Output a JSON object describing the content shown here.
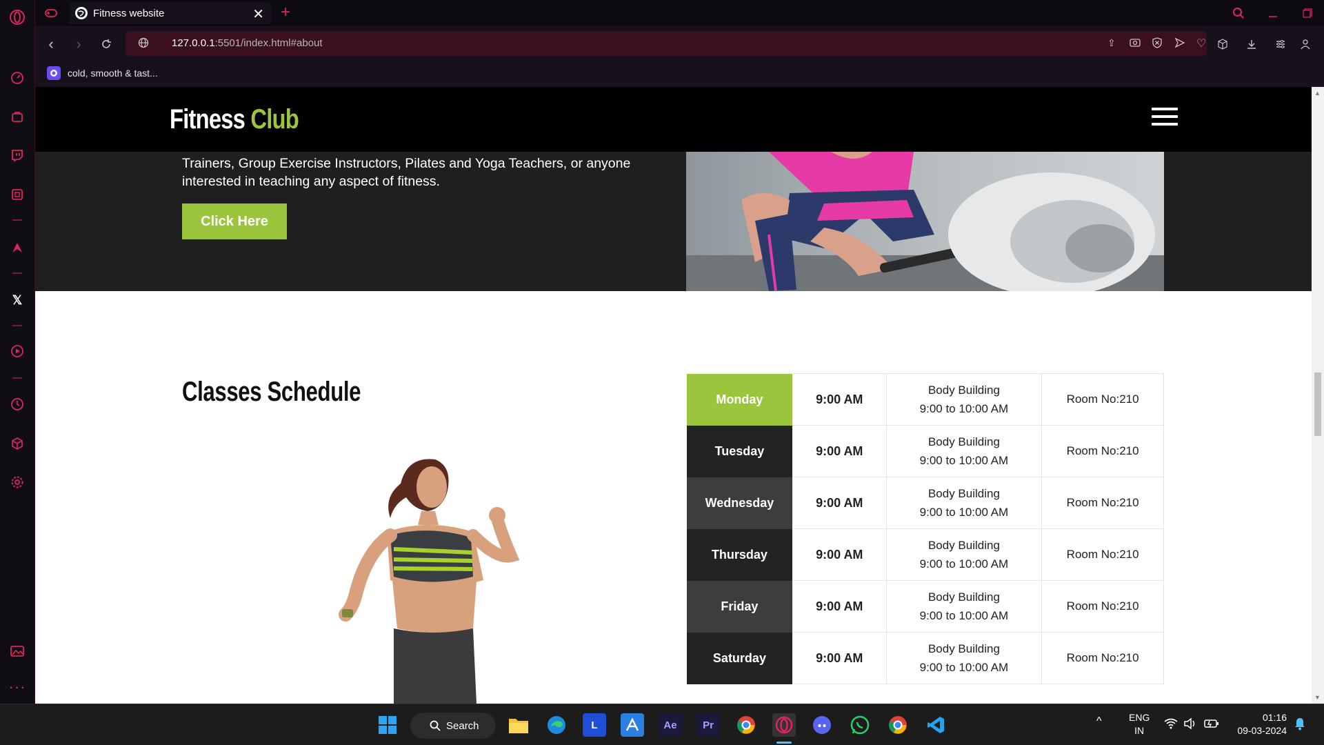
{
  "browser": {
    "tab_title": "Fitness website",
    "url_host": "127.0.0.1",
    "url_rest": ":5501/index.html#about",
    "bookmark_label": "cold, smooth & tast..."
  },
  "site": {
    "logo_main": "Fitness",
    "logo_accent": "Club",
    "about_text": "Trainers, Group Exercise Instructors, Pilates and Yoga Teachers, or anyone interested in teaching any aspect of fitness.",
    "cta_label": "Click Here",
    "schedule_title": "Classes Schedule",
    "schedule": [
      {
        "day": "Monday",
        "time": "9:00 AM",
        "class": "Body Building",
        "hours": "9:00 to 10:00 AM",
        "room": "Room No:210",
        "color": "#9bc53d"
      },
      {
        "day": "Tuesday",
        "time": "9:00 AM",
        "class": "Body Building",
        "hours": "9:00 to 10:00 AM",
        "room": "Room No:210",
        "color": "#232323"
      },
      {
        "day": "Wednesday",
        "time": "9:00 AM",
        "class": "Body Building",
        "hours": "9:00 to 10:00 AM",
        "room": "Room No:210",
        "color": "#3d3d3d"
      },
      {
        "day": "Thursday",
        "time": "9:00 AM",
        "class": "Body Building",
        "hours": "9:00 to 10:00 AM",
        "room": "Room No:210",
        "color": "#232323"
      },
      {
        "day": "Friday",
        "time": "9:00 AM",
        "class": "Body Building",
        "hours": "9:00 to 10:00 AM",
        "room": "Room No:210",
        "color": "#3d3d3d"
      },
      {
        "day": "Saturday",
        "time": "9:00 AM",
        "class": "Body Building",
        "hours": "9:00 to 10:00 AM",
        "room": "Room No:210",
        "color": "#232323"
      }
    ]
  },
  "taskbar": {
    "search_label": "Search",
    "lang": "ENG",
    "region": "IN",
    "time": "01:16",
    "date": "09-03-2024",
    "apps": [
      "windows-start",
      "file-explorer",
      "edge",
      "l-app",
      "affinity",
      "after-effects",
      "premiere-pro",
      "chrome",
      "opera",
      "discord",
      "whatsapp",
      "chrome-beta",
      "vscode"
    ]
  },
  "colors": {
    "accent_green": "#9bc53d",
    "opera_red": "#e0245e",
    "nav_bg": "#000000",
    "about_bg": "#1f1f1f"
  }
}
